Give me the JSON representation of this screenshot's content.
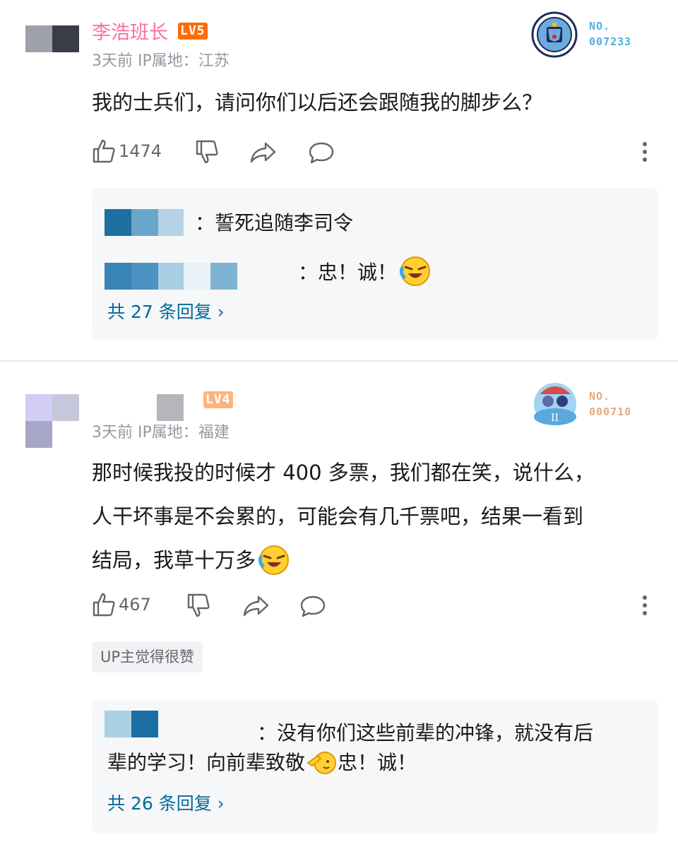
{
  "comments": [
    {
      "username": "李浩班长",
      "level": "LV5",
      "meta": "3天前  IP属地：江苏",
      "content": "我的士兵们，请问你们以后还会跟随我的脚步么？",
      "likes": "1474",
      "badge": {
        "line1": "NO.",
        "line2": "007233"
      },
      "replies": [
        {
          "text": "：誓死追随李司令"
        },
        {
          "text": "：忠！诚！"
        }
      ],
      "more_replies": "共 27 条回复 ›"
    },
    {
      "username": "",
      "level": "LV4",
      "meta": "3天前  IP属地：福建",
      "content_lines": [
        "那时候我投的时候才 400 多票，我们都在笑，说什么，",
        "人干坏事是不会累的，可能会有几千票吧，结果一看到",
        "结局，我草十万多"
      ],
      "likes": "467",
      "badge": {
        "line1": "NO.",
        "line2": "000710"
      },
      "up_tag": "UP主觉得很赞",
      "replies": [
        {
          "text_line1": "：没有你们这些前辈的冲锋，就没有后",
          "text_line2": "辈的学习！向前辈致敬",
          "text_line2_tail": "忠！诚！"
        }
      ],
      "more_replies": "共 26 条回复 ›"
    }
  ],
  "colors": {
    "pink": "#fb7299",
    "lv5": "#ff6c00",
    "lv4": "#ffb37c",
    "link": "#00699d",
    "badge_text": "#4fb0e6",
    "badge_text2": "#e8a87c"
  }
}
